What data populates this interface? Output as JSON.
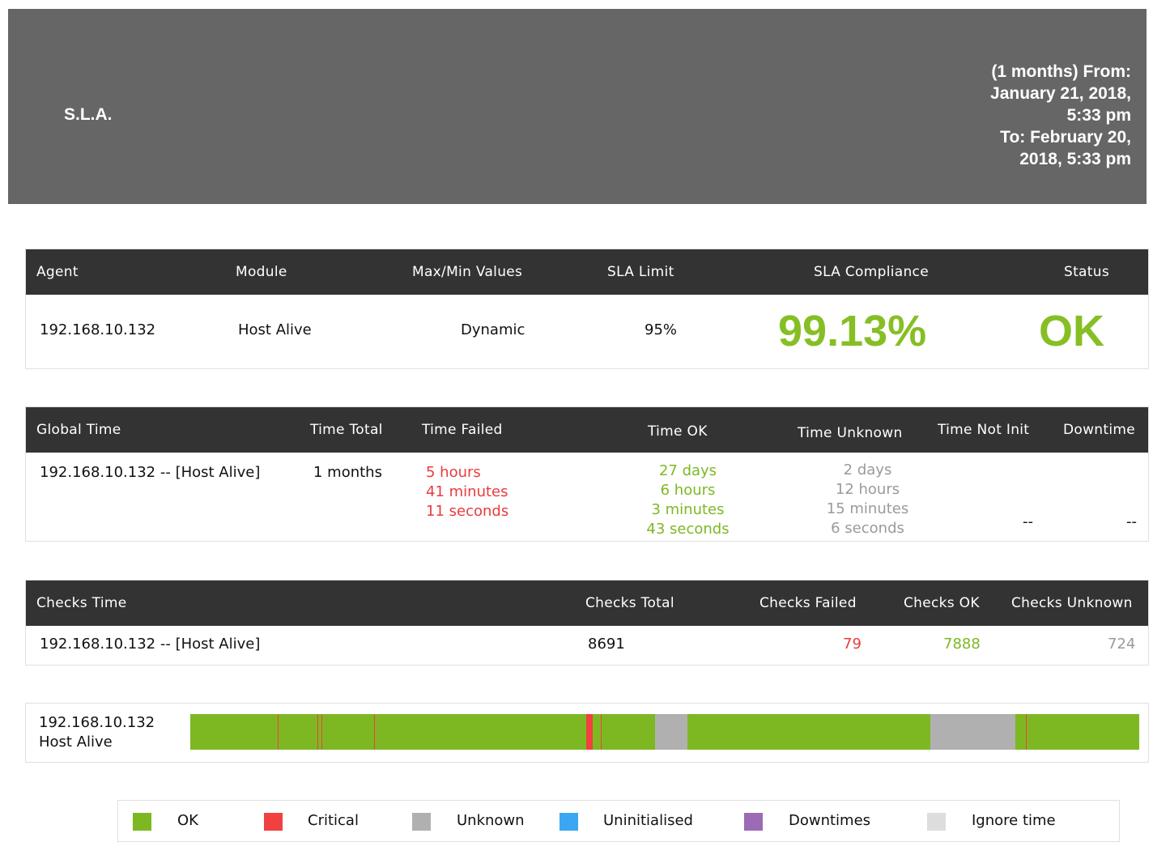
{
  "header": {
    "title": "S.L.A.",
    "range_lines": [
      "(1 months) From:",
      "January 21, 2018,",
      "5:33 pm",
      "To: February 20,",
      "2018, 5:33 pm"
    ]
  },
  "sla_table": {
    "headers": [
      "Agent",
      "Module",
      "Max/Min Values",
      "SLA Limit",
      "SLA Compliance",
      "Status"
    ],
    "agent": "192.168.10.132",
    "module": "Host Alive",
    "maxmin": "Dynamic",
    "limit": "95%",
    "compliance": "99.13%",
    "status": "OK"
  },
  "global_time": {
    "headers": [
      "Global Time",
      "Time Total",
      "Time Failed",
      "Time OK",
      "Time Unknown",
      "Time Not Init",
      "Downtime"
    ],
    "item": "192.168.10.132 -- [Host Alive]",
    "total": "1 months",
    "failed": [
      "5 hours",
      "41 minutes",
      "11 seconds"
    ],
    "ok": [
      "27 days",
      "6 hours",
      "3 minutes",
      "43 seconds"
    ],
    "unknown": [
      "2 days",
      "12 hours",
      "15 minutes",
      "6 seconds"
    ],
    "not_init": "--",
    "downtime": "--"
  },
  "checks_time": {
    "headers": [
      "Checks Time",
      "Checks Total",
      "Checks Failed",
      "Checks OK",
      "Checks Unknown"
    ],
    "item": "192.168.10.132 -- [Host Alive]",
    "total": "8691",
    "failed": "79",
    "ok": "7888",
    "unknown": "724"
  },
  "timeline": {
    "agent": "192.168.10.132",
    "module": "Host Alive",
    "segments": [
      {
        "state": "ok",
        "start": 0.0,
        "end": 1.0
      },
      {
        "state": "critical",
        "start": 0.0925,
        "end": 0.0935
      },
      {
        "state": "critical",
        "start": 0.1338,
        "end": 0.1348
      },
      {
        "state": "critical",
        "start": 0.1385,
        "end": 0.1395
      },
      {
        "state": "critical",
        "start": 0.194,
        "end": 0.195
      },
      {
        "state": "critical",
        "start": 0.4175,
        "end": 0.424
      },
      {
        "state": "critical",
        "start": 0.4325,
        "end": 0.4335
      },
      {
        "state": "unknown",
        "start": 0.4895,
        "end": 0.524
      },
      {
        "state": "unknown",
        "start": 0.7795,
        "end": 0.869
      },
      {
        "state": "critical",
        "start": 0.8805,
        "end": 0.8815
      }
    ]
  },
  "legend": [
    {
      "label": "OK",
      "color": "#7db823"
    },
    {
      "label": "Critical",
      "color": "#f24040"
    },
    {
      "label": "Unknown",
      "color": "#b0b0b0"
    },
    {
      "label": "Uninitialised",
      "color": "#3ba7f2"
    },
    {
      "label": "Downtimes",
      "color": "#9b6bb5"
    },
    {
      "label": "Ignore time",
      "color": "#dddddd"
    }
  ],
  "colors": {
    "ok": "#7db823",
    "critical": "#f24040",
    "unknown": "#b0b0b0",
    "header_bg": "#666666",
    "table_head": "#333333"
  }
}
